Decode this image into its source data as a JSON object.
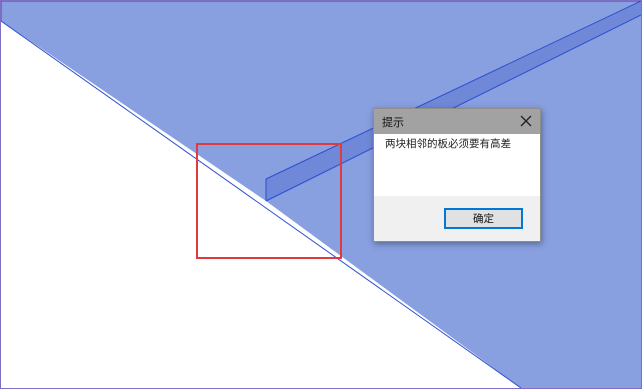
{
  "dialog": {
    "title": "提示",
    "message": "两块相邻的板必须要有高差",
    "ok_label": "确定",
    "close_icon": "close-icon"
  },
  "colors": {
    "slab_fill": "#8a9fe0",
    "slab_edge": "#2b4fd0",
    "selection_border": "#e0393e",
    "button_focus_border": "#0078d7",
    "titlebar": "#a2a2a2"
  }
}
